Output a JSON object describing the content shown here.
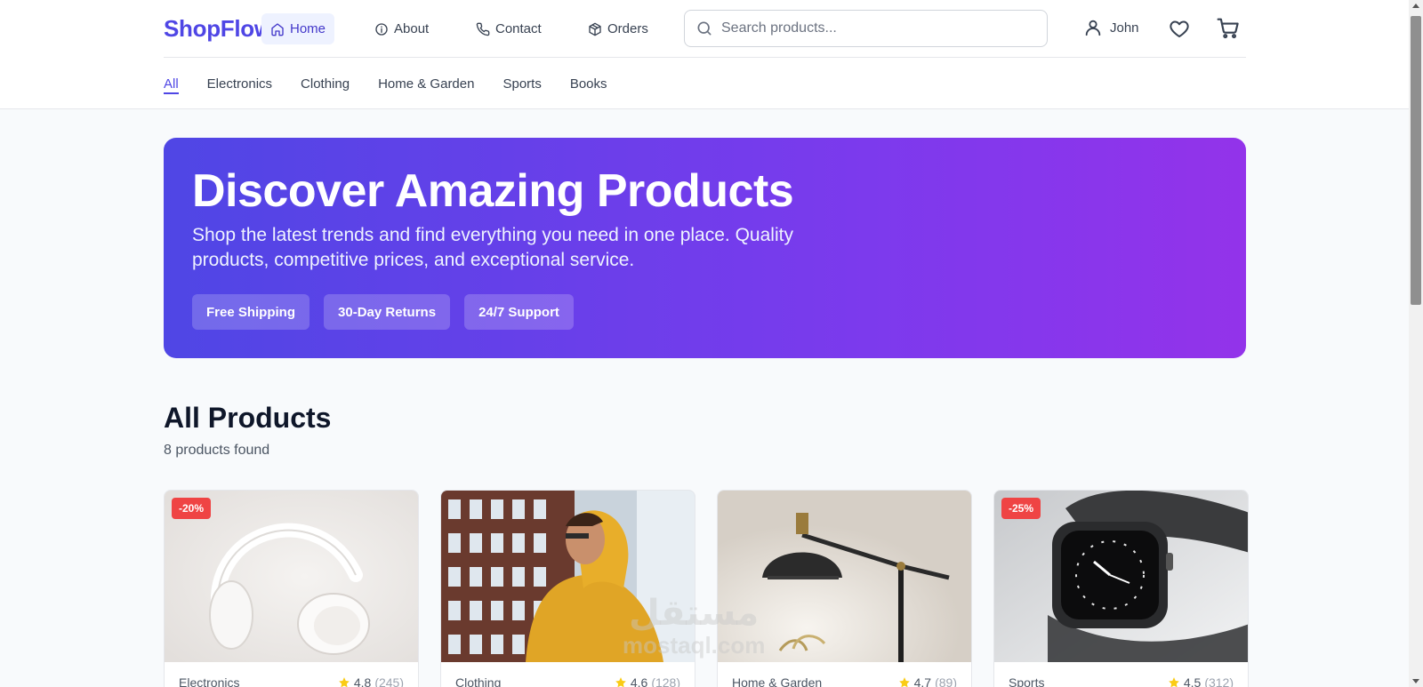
{
  "brand": {
    "name": "ShopFlow",
    "color": "#4f46e5"
  },
  "nav": [
    {
      "label": "Home",
      "icon": "home-icon",
      "active": true
    },
    {
      "label": "About",
      "icon": "info-icon",
      "active": false
    },
    {
      "label": "Contact",
      "icon": "phone-icon",
      "active": false
    },
    {
      "label": "Orders",
      "icon": "package-icon",
      "active": false
    }
  ],
  "search": {
    "placeholder": "Search products...",
    "value": ""
  },
  "user": {
    "name": "John"
  },
  "categories": [
    {
      "label": "All",
      "active": true
    },
    {
      "label": "Electronics",
      "active": false
    },
    {
      "label": "Clothing",
      "active": false
    },
    {
      "label": "Home & Garden",
      "active": false
    },
    {
      "label": "Sports",
      "active": false
    },
    {
      "label": "Books",
      "active": false
    }
  ],
  "hero": {
    "title": "Discover Amazing Products",
    "subtitle": "Shop the latest trends and find everything you need in one place. Quality products, competitive prices, and exceptional service.",
    "chips": [
      "Free Shipping",
      "30-Day Returns",
      "24/7 Support"
    ]
  },
  "products_section": {
    "title": "All Products",
    "count_text": "8 products found"
  },
  "products": [
    {
      "category": "Electronics",
      "rating": "4.8",
      "reviews": "(245)",
      "discount": "-20%",
      "image": "white-headphones"
    },
    {
      "category": "Clothing",
      "rating": "4.6",
      "reviews": "(128)",
      "discount": "",
      "image": "yellow-hoodie"
    },
    {
      "category": "Home & Garden",
      "rating": "4.7",
      "reviews": "(89)",
      "discount": "",
      "image": "desk-lamp"
    },
    {
      "category": "Sports",
      "rating": "4.5",
      "reviews": "(312)",
      "discount": "-25%",
      "image": "smartwatch"
    }
  ],
  "watermark": {
    "text": "مستقل",
    "sub": "mostaql.com"
  },
  "colors": {
    "accent": "#4f46e5",
    "sale": "#ef4444",
    "star": "#facc15",
    "hero_from": "#4f46e5",
    "hero_to": "#9333ea"
  }
}
